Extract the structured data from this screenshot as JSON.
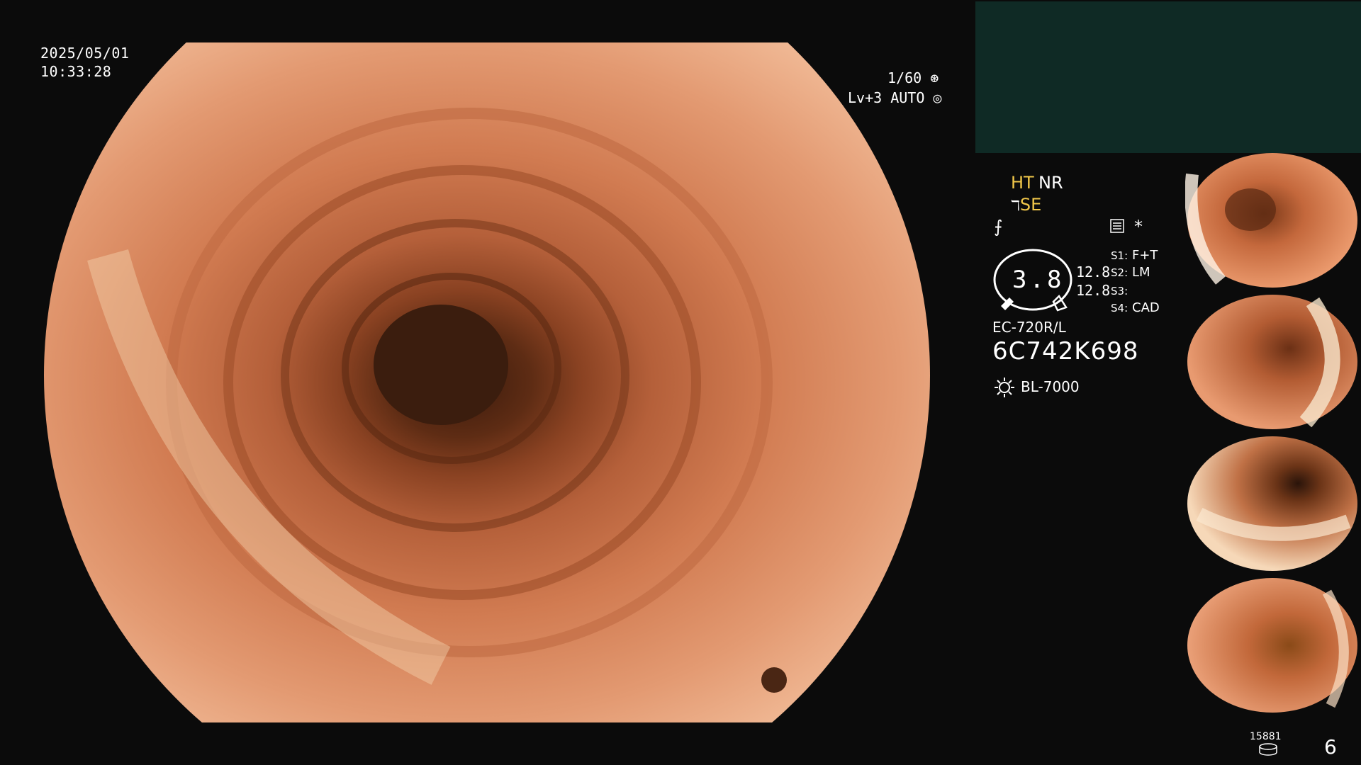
{
  "overlay": {
    "date": "2025/05/01",
    "time": "10:33:28",
    "shutter": "1/60",
    "level": "Lv+3 AUTO"
  },
  "status": {
    "ht": "HT",
    "nr": "NR",
    "se": "SE",
    "zoom_value": "3.8",
    "value_1": "12.8",
    "value_2": "12.8",
    "scope_model": "EC-720R/L",
    "scope_serial": "6C742K698",
    "light_source": "BL-7000",
    "switches": [
      {
        "key": "S1:",
        "value": "F+T"
      },
      {
        "key": "S2:",
        "value": "LM"
      },
      {
        "key": "S3:",
        "value": ""
      },
      {
        "key": "S4:",
        "value": "CAD"
      }
    ],
    "star": "*"
  },
  "footer": {
    "counter": "15881",
    "page_number": "6"
  },
  "colors": {
    "accent_yellow": "#f2c84a",
    "teal_panel": "#0f2a25",
    "background": "#0b0b0b"
  },
  "icons": [
    "aperture-icon",
    "iris-icon",
    "menu-icon",
    "sun-lamp-icon",
    "wave-icon",
    "flat-icon",
    "stack-icon"
  ]
}
